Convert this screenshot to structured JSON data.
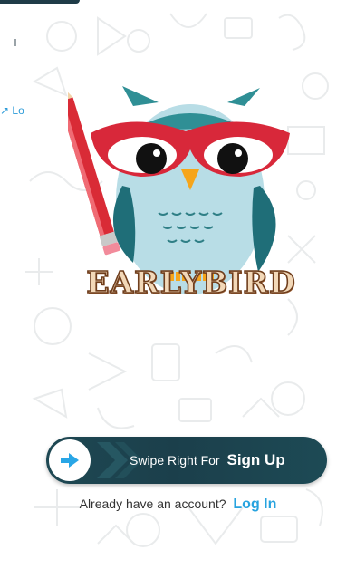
{
  "colors": {
    "accent": "#27a3df",
    "swipe_bg": "#1d4652",
    "brand_fill": "#f2d8b8",
    "brand_stroke": "#6f3e1d"
  },
  "top_hint": "↗ Lo",
  "brand": {
    "name": "EARLYBIRD",
    "logo_icon": "owl-with-pencil-logo"
  },
  "swipe": {
    "prefix": "Swipe Right For",
    "action": "Sign Up",
    "icon": "arrow-right-icon"
  },
  "login": {
    "question": "Already have an account?",
    "link": "Log In"
  }
}
